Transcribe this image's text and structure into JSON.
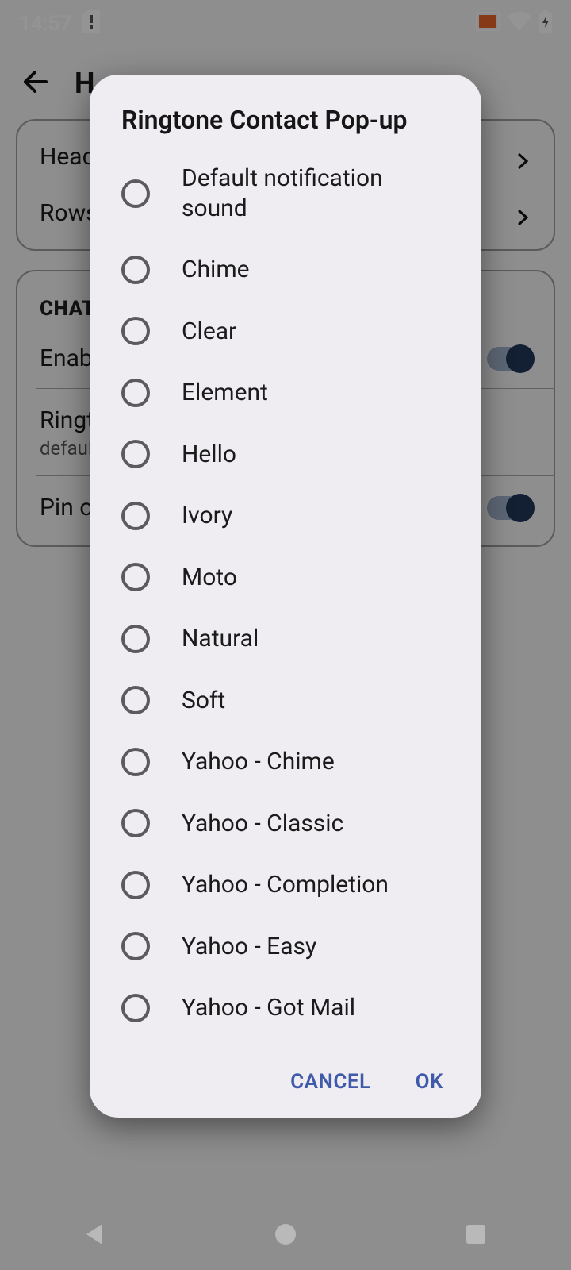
{
  "status": {
    "time": "14:57",
    "cast_active": true,
    "wifi": true,
    "battery_charging": true
  },
  "page": {
    "title_partial": "H",
    "card1": {
      "row1": "Head",
      "row2": "Rows"
    },
    "section_label": "CHAT",
    "enable_row": "Enabl",
    "ringtone_row": {
      "title": "Ringt",
      "subtitle": "default"
    },
    "pin_row": "Pin o"
  },
  "dialog": {
    "title": "Ringtone Contact Pop-up",
    "options": [
      "Default notification sound",
      "Chime",
      "Clear",
      "Element",
      "Hello",
      "Ivory",
      "Moto",
      "Natural",
      "Soft",
      "Yahoo - Chime",
      "Yahoo - Classic",
      "Yahoo - Completion",
      "Yahoo - Easy",
      "Yahoo - Got Mail"
    ],
    "cancel": "CANCEL",
    "ok": "OK"
  }
}
